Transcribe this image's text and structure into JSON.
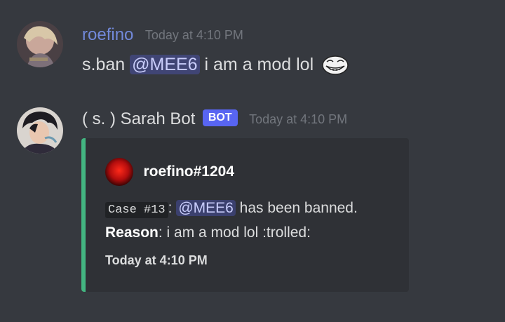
{
  "colors": {
    "background": "#36393f",
    "embed_bg": "#2f3136",
    "embed_accent": "#43b581",
    "user1_name": "#7289da",
    "bot_tag": "#5865f2",
    "timestamp": "#72767d"
  },
  "messages": [
    {
      "username": "roefino",
      "timestamp": "Today at 4:10 PM",
      "content": {
        "before": "s.ban ",
        "mention": "@MEE6",
        "after": " i am a mod lol",
        "emoji": "trollface-emoji"
      },
      "avatar_icon": "user-avatar"
    },
    {
      "username": "( s. ) Sarah Bot",
      "bot_tag": "BOT",
      "timestamp": "Today at 4:10 PM",
      "avatar_icon": "bot-avatar",
      "embed": {
        "author_name": "roefino#1204",
        "author_icon": "red-avatar",
        "case_label": "Case #13",
        "case_sep": ":",
        "mention": "@MEE6",
        "banned_text": " has been banned.",
        "reason_label": "Reason",
        "reason_text": ": i am a mod lol :trolled:",
        "footer": "Today at 4:10 PM"
      }
    }
  ]
}
